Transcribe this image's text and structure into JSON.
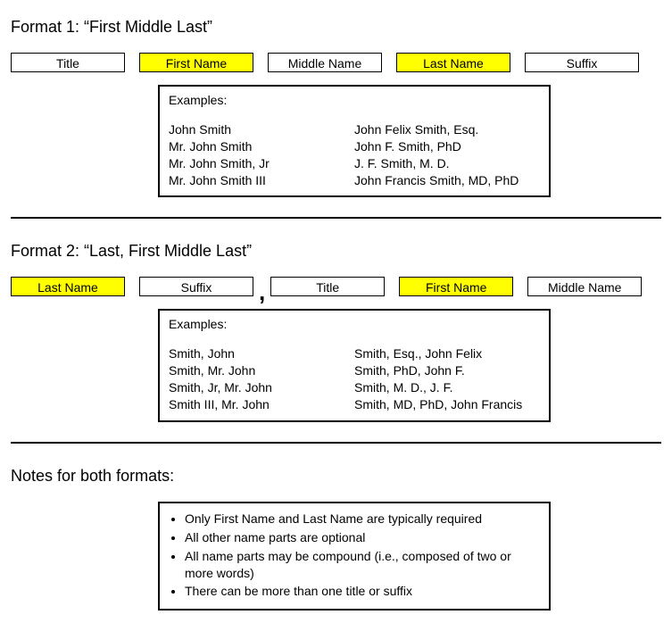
{
  "format1": {
    "heading": "Format 1: “First Middle Last”",
    "fields": {
      "title": "Title",
      "first": "First Name",
      "middle": "Middle Name",
      "last": "Last Name",
      "suffix": "Suffix"
    },
    "examples_label": "Examples:",
    "examples_left": [
      "John Smith",
      "Mr. John Smith",
      "Mr. John Smith, Jr",
      "Mr. John Smith III"
    ],
    "examples_right": [
      "John Felix Smith, Esq.",
      "John F. Smith, PhD",
      "J. F. Smith, M. D.",
      "John Francis Smith, MD, PhD"
    ]
  },
  "format2": {
    "heading": "Format 2: “Last, First Middle Last”",
    "fields": {
      "last": "Last Name",
      "suffix": "Suffix",
      "title": "Title",
      "first": "First Name",
      "middle": "Middle Name"
    },
    "comma": ",",
    "examples_label": "Examples:",
    "examples_left": [
      "Smith, John",
      "Smith, Mr. John",
      "Smith, Jr, Mr. John",
      "Smith III, Mr. John"
    ],
    "examples_right": [
      "Smith, Esq., John Felix",
      "Smith, PhD, John F.",
      "Smith, M. D., J. F.",
      "Smith, MD, PhD, John Francis"
    ]
  },
  "notes": {
    "heading": "Notes for both formats:",
    "items": [
      "Only First Name and Last Name are typically required",
      "All other name parts are optional",
      "All name parts may be compound (i.e., composed of two or more words)",
      "There can be more than one title or suffix"
    ]
  }
}
